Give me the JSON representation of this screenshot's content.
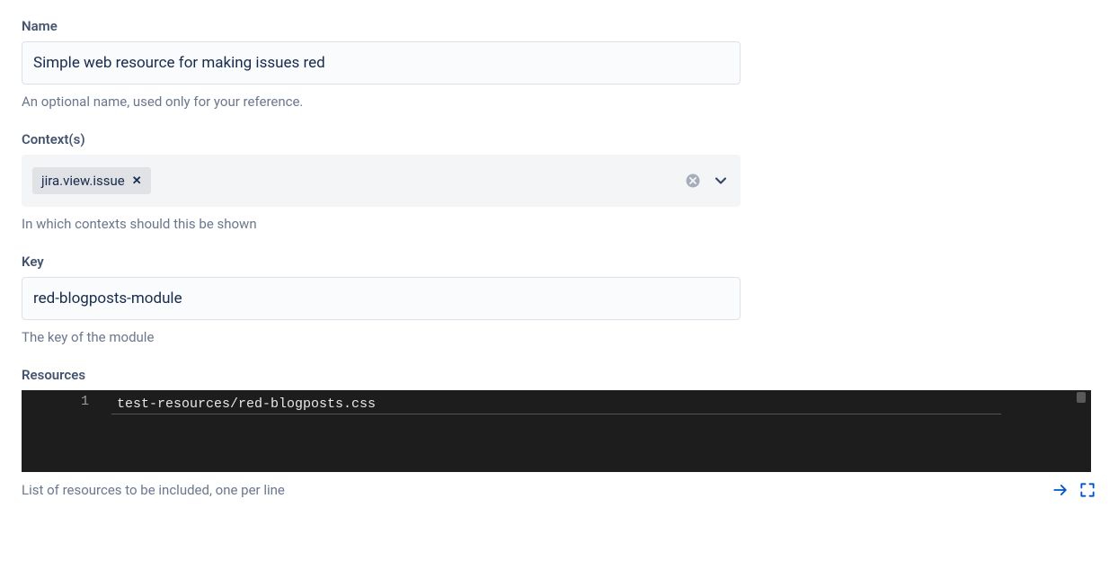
{
  "fields": {
    "name": {
      "label": "Name",
      "value": "Simple web resource for making issues red",
      "description": "An optional name, used only for your reference."
    },
    "contexts": {
      "label": "Context(s)",
      "tags": [
        "jira.view.issue"
      ],
      "description": "In which contexts should this be shown"
    },
    "key": {
      "label": "Key",
      "value": "red-blogposts-module",
      "description": "The key of the module"
    },
    "resources": {
      "label": "Resources",
      "lines": [
        "test-resources/red-blogposts.css"
      ],
      "line_numbers": [
        "1"
      ],
      "description": "List of resources to be included, one per line"
    }
  }
}
